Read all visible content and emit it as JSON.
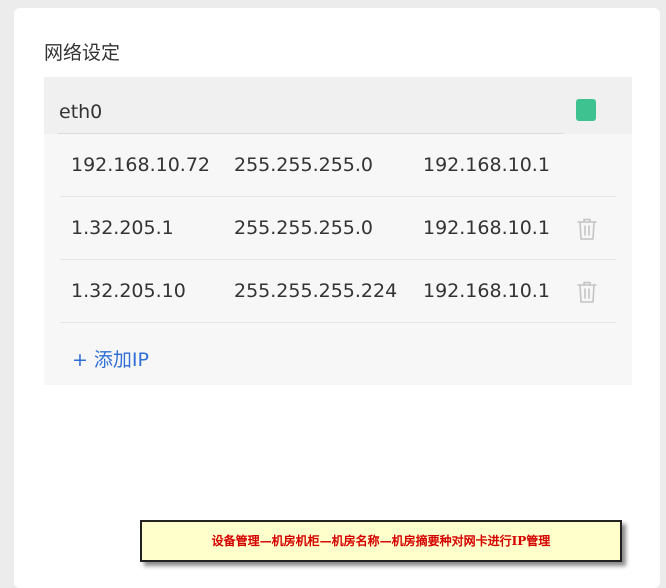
{
  "section": {
    "title": "网络设定"
  },
  "interface": {
    "name": "eth0",
    "status_color": "#3ec28f"
  },
  "ip_rows": [
    {
      "ip": "192.168.10.72",
      "mask": "255.255.255.0",
      "gateway": "192.168.10.1",
      "deletable": false
    },
    {
      "ip": "1.32.205.1",
      "mask": "255.255.255.0",
      "gateway": "192.168.10.1",
      "deletable": true
    },
    {
      "ip": "1.32.205.10",
      "mask": "255.255.255.224",
      "gateway": "192.168.10.1",
      "deletable": true
    }
  ],
  "add_ip": {
    "plus": "+",
    "label": "添加IP"
  },
  "caption": {
    "text": "设备管理—机房机柜—机房名称—机房摘要种对网卡进行IP管理"
  },
  "colors": {
    "accent": "#2f6fd6",
    "status": "#3ec28f",
    "caption_text": "#d40000",
    "caption_bg": "#ffffcc"
  }
}
